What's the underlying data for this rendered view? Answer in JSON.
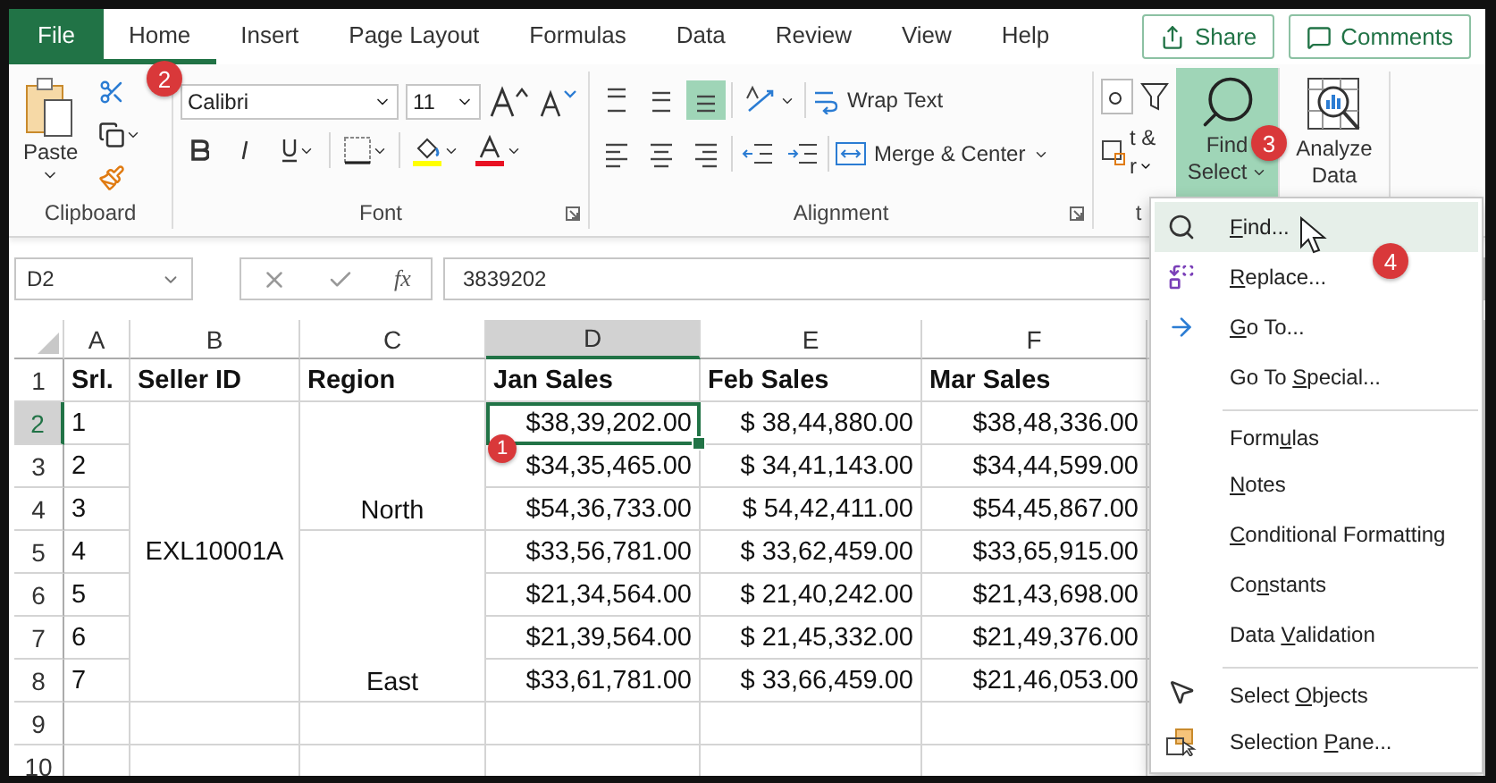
{
  "tabs": [
    {
      "label": "File",
      "kind": "file"
    },
    {
      "label": "Home",
      "kind": "tab",
      "selected": true
    },
    {
      "label": "Insert",
      "kind": "tab",
      "selected": false
    },
    {
      "label": "Page Layout",
      "kind": "tab",
      "selected": false
    },
    {
      "label": "Formulas",
      "kind": "tab",
      "selected": false
    },
    {
      "label": "Data",
      "kind": "tab",
      "selected": false
    },
    {
      "label": "Review",
      "kind": "tab",
      "selected": false
    },
    {
      "label": "View",
      "kind": "tab",
      "selected": false
    },
    {
      "label": "Help",
      "kind": "tab",
      "selected": false
    }
  ],
  "share": "Share",
  "comments": "Comments",
  "ribbon": {
    "clipboard": {
      "paste": "Paste",
      "label": "Clipboard"
    },
    "font": {
      "name": "Calibri",
      "size": "11",
      "label": "Font"
    },
    "alignment": {
      "wrap": "Wrap Text",
      "merge": "Merge & Center",
      "label": "Alignment"
    },
    "sort_filter": {
      "line1": "t &",
      "line2": "r",
      "label": "t"
    },
    "find_select": {
      "line1": "Find",
      "line2": "Select",
      "selected": true
    },
    "analyze": {
      "line1": "Analyze",
      "line2": "Data"
    }
  },
  "formula_bar": {
    "name_box": "D2",
    "fx": "fx",
    "formula": "3839202"
  },
  "sheet": {
    "columns": [
      {
        "label": "A",
        "selected": false
      },
      {
        "label": "B",
        "selected": false
      },
      {
        "label": "C",
        "selected": false
      },
      {
        "label": "D",
        "selected": true
      },
      {
        "label": "E",
        "selected": false
      },
      {
        "label": "F",
        "selected": false
      }
    ],
    "row_numbers": [
      {
        "label": "1",
        "selected": false
      },
      {
        "label": "2",
        "selected": true
      },
      {
        "label": "3",
        "selected": false
      },
      {
        "label": "4",
        "selected": false
      },
      {
        "label": "5",
        "selected": false
      },
      {
        "label": "6",
        "selected": false
      },
      {
        "label": "7",
        "selected": false
      },
      {
        "label": "8",
        "selected": false
      },
      {
        "label": "9",
        "selected": false
      },
      {
        "label": "10",
        "selected": false
      }
    ],
    "header": [
      "Srl.",
      "Seller ID",
      "Region",
      "Jan Sales",
      "Feb Sales",
      "Mar Sales"
    ],
    "seller": "EXL10001A",
    "regions": [
      {
        "label": "North",
        "rows": [
          {
            "srl": "1",
            "jan": "$38,39,202.00",
            "feb": "$ 38,44,880.00",
            "mar": "$38,48,336.00",
            "selected": true
          },
          {
            "srl": "2",
            "jan": "$34,35,465.00",
            "feb": "$ 34,41,143.00",
            "mar": "$34,44,599.00",
            "selected": false
          },
          {
            "srl": "3",
            "jan": "$54,36,733.00",
            "feb": "$ 54,42,411.00",
            "mar": "$54,45,867.00",
            "selected": false
          }
        ]
      },
      {
        "label": "East",
        "rows": [
          {
            "srl": "4",
            "jan": "$33,56,781.00",
            "feb": "$ 33,62,459.00",
            "mar": "$33,65,915.00",
            "selected": false
          },
          {
            "srl": "5",
            "jan": "$21,34,564.00",
            "feb": "$ 21,40,242.00",
            "mar": "$21,43,698.00",
            "selected": false
          },
          {
            "srl": "6",
            "jan": "$21,39,564.00",
            "feb": "$ 21,45,332.00",
            "mar": "$21,49,376.00",
            "selected": false
          },
          {
            "srl": "7",
            "jan": "$33,61,781.00",
            "feb": "$ 33,66,459.00",
            "mar": "$21,46,053.00",
            "selected": false
          }
        ]
      }
    ]
  },
  "menu": {
    "items": [
      {
        "kind": "find",
        "key": "F",
        "post": "ind...",
        "selected": true,
        "divider_before": false
      },
      {
        "kind": "replace",
        "key": "R",
        "post": "eplace...",
        "selected": false,
        "divider_before": false
      },
      {
        "kind": "goto",
        "key": "G",
        "post": "o To...",
        "selected": false,
        "divider_before": false
      },
      {
        "kind": "plain",
        "pre": "Go To ",
        "key": "S",
        "post": "pecial...",
        "selected": false,
        "divider_before": false
      },
      {
        "kind": "plain",
        "pre": "Form",
        "key": "u",
        "post": "las",
        "selected": false,
        "divider_before": true
      },
      {
        "kind": "plain",
        "key": "N",
        "post": "otes",
        "selected": false,
        "divider_before": false
      },
      {
        "kind": "plain",
        "key": "C",
        "post": "onditional Formatting",
        "selected": false,
        "divider_before": false
      },
      {
        "kind": "plain",
        "pre": "Co",
        "key": "n",
        "post": "stants",
        "selected": false,
        "divider_before": false
      },
      {
        "kind": "plain",
        "pre": "Data ",
        "key": "V",
        "post": "alidation",
        "selected": false,
        "divider_before": false
      },
      {
        "kind": "pointer",
        "pre": "Select ",
        "key": "O",
        "post": "bjects",
        "selected": false,
        "divider_before": true
      },
      {
        "kind": "pane",
        "pre": "Selection ",
        "key": "P",
        "post": "ane...",
        "selected": false,
        "divider_before": false
      }
    ]
  },
  "step_badges": [
    {
      "label": "1"
    },
    {
      "label": "2"
    },
    {
      "label": "3"
    },
    {
      "label": "4"
    }
  ]
}
